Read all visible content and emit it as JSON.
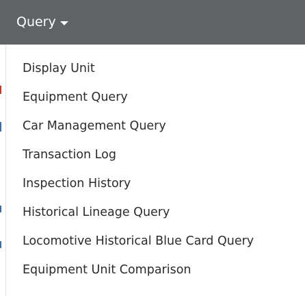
{
  "header": {
    "menu_label": "Query",
    "caret_icon": "caret-down-icon",
    "background_color": "#5f6366"
  },
  "menu": {
    "items": [
      {
        "label": "Display Unit"
      },
      {
        "label": "Equipment Query"
      },
      {
        "label": "Car Management Query"
      },
      {
        "label": "Transaction Log"
      },
      {
        "label": "Inspection History"
      },
      {
        "label": "Historical Lineage Query"
      },
      {
        "label": "Locomotive Historical Blue Card Query"
      },
      {
        "label": "Equipment Unit Comparison"
      }
    ]
  }
}
